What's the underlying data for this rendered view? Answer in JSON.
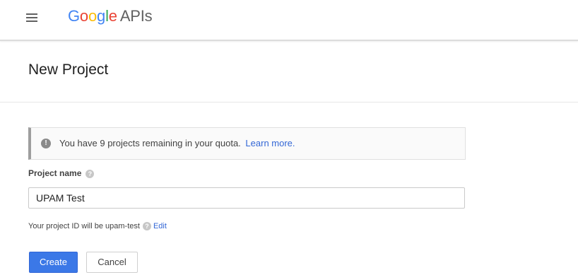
{
  "header": {
    "brand_google": "Google",
    "brand_product": "APIs",
    "menu_icon": "hamburger-menu-icon"
  },
  "page": {
    "title": "New Project"
  },
  "quota_notice": {
    "icon": "info-icon",
    "text": "You have 9 projects remaining in your quota.",
    "link_label": "Learn more."
  },
  "form": {
    "project_name_label": "Project name",
    "project_name_value": "UPAM Test",
    "project_id_prefix": "Your project ID will be upam-test",
    "edit_label": "Edit",
    "help_icon": "question-mark-icon"
  },
  "actions": {
    "create_label": "Create",
    "cancel_label": "Cancel"
  },
  "colors": {
    "google_blue": "#4285F4",
    "google_red": "#EA4335",
    "google_yellow": "#FBBC05",
    "google_green": "#34A853",
    "primary_button": "#3b78e7",
    "link": "#3367d6"
  }
}
